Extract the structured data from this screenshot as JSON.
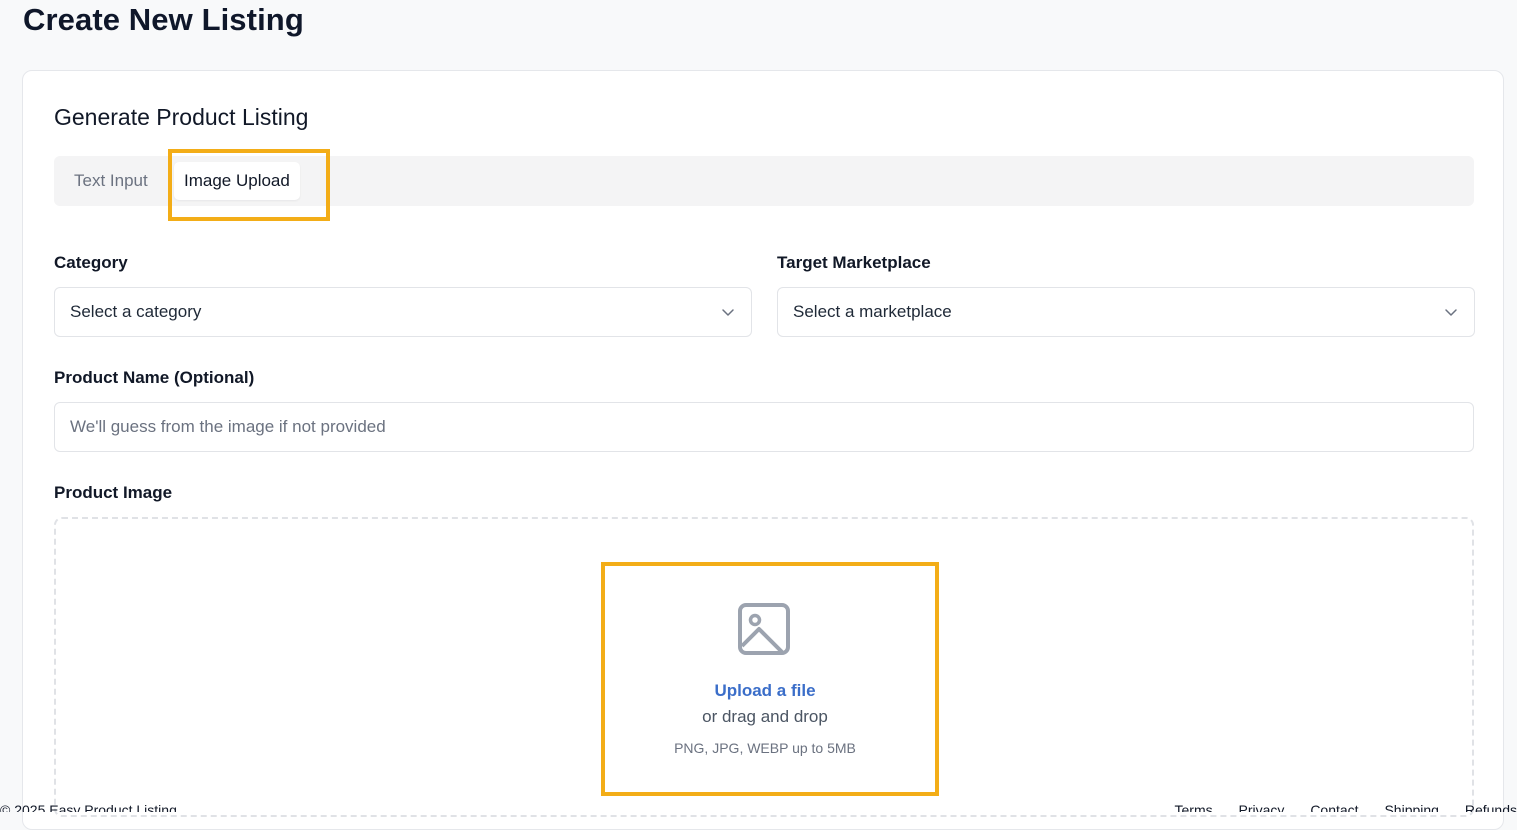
{
  "page": {
    "title": "Create New Listing"
  },
  "card": {
    "title": "Generate Product Listing"
  },
  "tabs": [
    {
      "label": "Text Input",
      "active": false
    },
    {
      "label": "Image Upload",
      "active": true
    }
  ],
  "form": {
    "category": {
      "label": "Category",
      "value": "Select a category"
    },
    "marketplace": {
      "label": "Target Marketplace",
      "value": "Select a marketplace"
    },
    "product_name": {
      "label": "Product Name (Optional)",
      "placeholder": "We'll guess from the image if not provided",
      "value": ""
    },
    "product_image": {
      "label": "Product Image",
      "upload_link": "Upload a file",
      "drag_text": "or drag and drop",
      "hint": "PNG, JPG, WEBP up to 5MB",
      "icon": "image-icon"
    }
  },
  "footer": {
    "copyright": "© 2025 Easy Product Listing",
    "links": [
      "Terms",
      "Privacy",
      "Contact",
      "Shipping",
      "Refunds"
    ]
  },
  "colors": {
    "highlight": "#f3ad17",
    "link": "#3b6ec9",
    "background": "#f8f9fa"
  }
}
